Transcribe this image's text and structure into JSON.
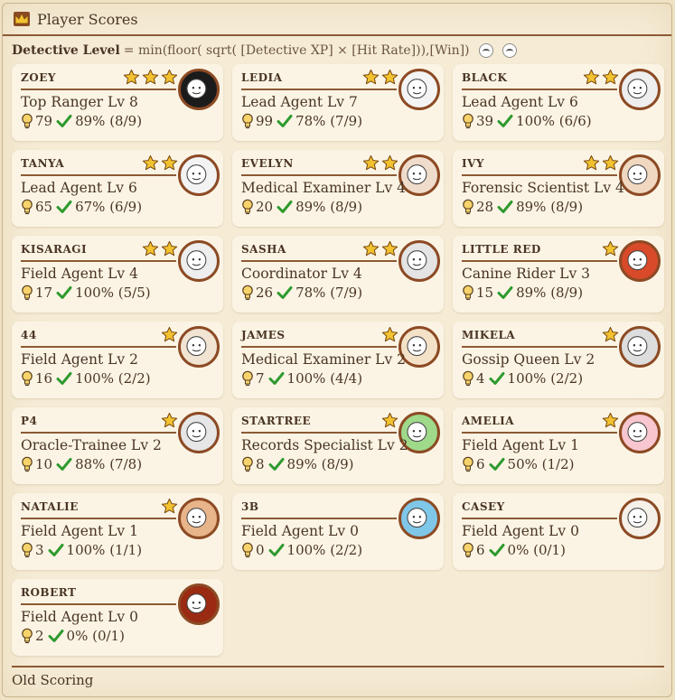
{
  "header": {
    "title": "Player Scores",
    "icon": "crown-icon"
  },
  "formula": {
    "label": "Detective Level",
    "text": "= min(floor( sqrt( [Detective XP] × [Hit Rate])),[Win])"
  },
  "colors": {
    "accent": "#8c5a35",
    "check": "#2e9a2e",
    "star": "#f2c230",
    "card": "#fbf4e4"
  },
  "players": [
    {
      "name": "ZOEY",
      "stars": 3,
      "rank": "Top Ranger Lv 8",
      "xp": "79",
      "rate": "89% (8/9)",
      "avatar_bg": "#1b1b1b"
    },
    {
      "name": "LEDIA",
      "stars": 2,
      "rank": "Lead Agent Lv 7",
      "xp": "99",
      "rate": "78% (7/9)",
      "avatar_bg": "#f4f4f4"
    },
    {
      "name": "BLACK",
      "stars": 2,
      "rank": "Lead Agent Lv 6",
      "xp": "39",
      "rate": "100% (6/6)",
      "avatar_bg": "#eeeeee"
    },
    {
      "name": "TANYA",
      "stars": 2,
      "rank": "Lead Agent Lv 6",
      "xp": "65",
      "rate": "67% (6/9)",
      "avatar_bg": "#f3f3f3"
    },
    {
      "name": "EVELYN",
      "stars": 2,
      "rank": "Medical Examiner Lv 4",
      "xp": "20",
      "rate": "89% (8/9)",
      "avatar_bg": "#f0dccb"
    },
    {
      "name": "IVY",
      "stars": 2,
      "rank": "Forensic Scientist Lv 4",
      "xp": "28",
      "rate": "89% (8/9)",
      "avatar_bg": "#f0d8c0"
    },
    {
      "name": "KISARAGI",
      "stars": 2,
      "rank": "Field Agent Lv 4",
      "xp": "17",
      "rate": "100% (5/5)",
      "avatar_bg": "#eeeeee"
    },
    {
      "name": "SASHA",
      "stars": 2,
      "rank": "Coordinator Lv 4",
      "xp": "26",
      "rate": "78% (7/9)",
      "avatar_bg": "#e4e4e4"
    },
    {
      "name": "LITTLE RED",
      "stars": 1,
      "rank": "Canine Rider Lv 3",
      "xp": "15",
      "rate": "89% (8/9)",
      "avatar_bg": "#d84a2a"
    },
    {
      "name": "44",
      "stars": 1,
      "rank": "Field Agent Lv 2",
      "xp": "16",
      "rate": "100% (2/2)",
      "avatar_bg": "#f1e4d2"
    },
    {
      "name": "JAMES",
      "stars": 1,
      "rank": "Medical Examiner Lv 2",
      "xp": "7",
      "rate": "100% (4/4)",
      "avatar_bg": "#f4e2c8"
    },
    {
      "name": "MIKELA",
      "stars": 1,
      "rank": "Gossip Queen Lv 2",
      "xp": "4",
      "rate": "100% (2/2)",
      "avatar_bg": "#dddddd"
    },
    {
      "name": "P4",
      "stars": 1,
      "rank": "Oracle-Trainee Lv 2",
      "xp": "10",
      "rate": "88% (7/8)",
      "avatar_bg": "#e6e6e6"
    },
    {
      "name": "STARTREE",
      "stars": 1,
      "rank": "Records Specialist Lv 2",
      "xp": "8",
      "rate": "89% (8/9)",
      "avatar_bg": "#9fd98a"
    },
    {
      "name": "AMELIA",
      "stars": 1,
      "rank": "Field Agent Lv 1",
      "xp": "6",
      "rate": "50% (1/2)",
      "avatar_bg": "#f7c6cf"
    },
    {
      "name": "NATALIE",
      "stars": 1,
      "rank": "Field Agent Lv 1",
      "xp": "3",
      "rate": "100% (1/1)",
      "avatar_bg": "#e8b48a"
    },
    {
      "name": "3B",
      "stars": 0,
      "rank": "Field Agent Lv 0",
      "xp": "0",
      "rate": "100% (2/2)",
      "avatar_bg": "#7fc7e8"
    },
    {
      "name": "CASEY",
      "stars": 0,
      "rank": "Field Agent Lv 0",
      "xp": "6",
      "rate": "0% (0/1)",
      "avatar_bg": "#f5f0e8"
    },
    {
      "name": "ROBERT",
      "stars": 0,
      "rank": "Field Agent Lv 0",
      "xp": "2",
      "rate": "0% (0/1)",
      "avatar_bg": "#9a2a12"
    }
  ],
  "footer": {
    "label": "Old Scoring"
  }
}
